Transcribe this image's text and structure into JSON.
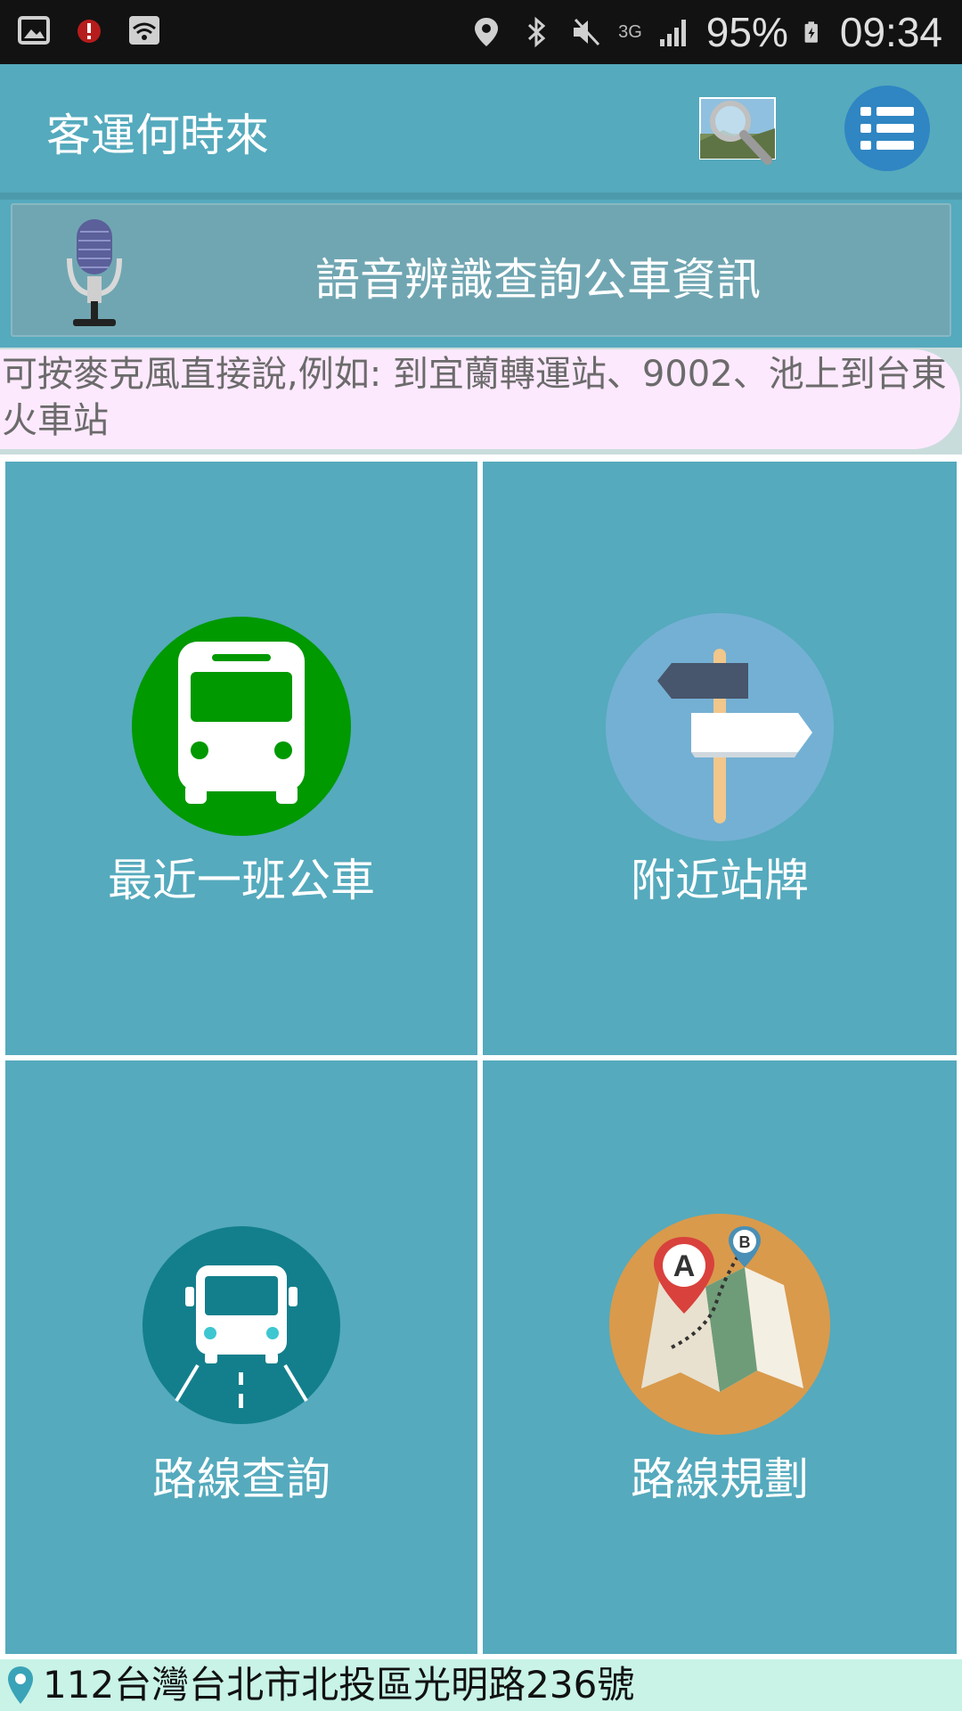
{
  "status_bar": {
    "battery": "95%",
    "time": "09:34",
    "network": "3G",
    "left_icons": [
      "gallery-icon",
      "alarm-icon",
      "wifi-icon"
    ],
    "right_icons": [
      "location-icon",
      "bluetooth-icon",
      "mute-icon",
      "signal-icon",
      "battery-icon"
    ]
  },
  "app_bar": {
    "title": "客運何時來",
    "actions": [
      "search-icon",
      "menu-icon"
    ]
  },
  "voice": {
    "label": "語音辨識查詢公車資訊",
    "icon": "microphone-icon"
  },
  "hint": {
    "text": "可按麥克風直接說,例如: 到宜蘭轉運站、9002、池上到台東火車站"
  },
  "tiles": [
    {
      "label": "最近一班公車",
      "icon": "bus-front-icon",
      "color": "#009900"
    },
    {
      "label": "附近站牌",
      "icon": "signpost-icon",
      "color": "#74b0d4"
    },
    {
      "label": "路線查詢",
      "icon": "bus-road-icon",
      "color": "#137f8c"
    },
    {
      "label": "路線規劃",
      "icon": "route-map-icon",
      "color": "#d99a4c"
    }
  ],
  "address": {
    "text": "112台灣台北市北投區光明路236號",
    "icon": "location-pin-icon"
  },
  "colors": {
    "background": "#55aabd",
    "status_bar": "#121212",
    "menu_button": "#2f86c3",
    "hint_background": "#fde9fd",
    "address_background": "#c8f3e6"
  }
}
